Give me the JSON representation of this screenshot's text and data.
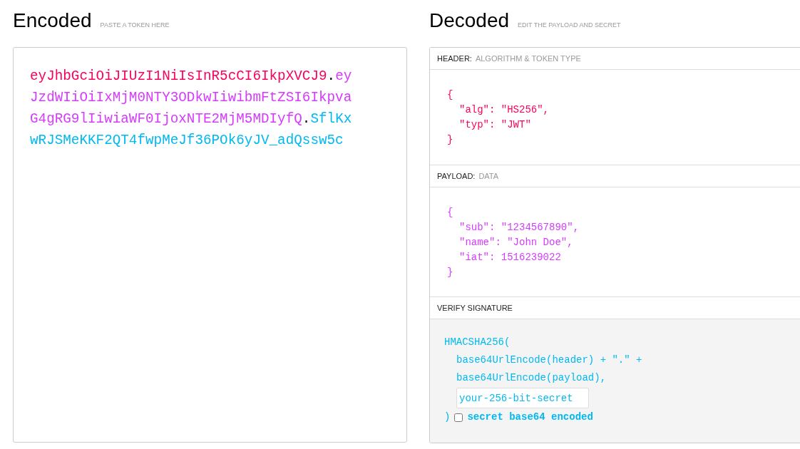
{
  "encoded": {
    "title": "Encoded",
    "hint": "PASTE A TOKEN HERE",
    "token": [
      {
        "text": "eyJhbGciOiJIUzI1NiIsInR5cCI6IkpXVCJ9",
        "color": "#fb015b"
      },
      {
        "text": ".",
        "color": "#000000"
      },
      {
        "text": "eyJzdWIiOiIxMjM0NTY3ODkwIiwibmFtZSI6IkpvaG4gRG9lIiwiaWF0IjoxNTE2MjM5MDIyfQ",
        "color": "#d63aff"
      },
      {
        "text": ".",
        "color": "#000000"
      },
      {
        "text": "SflKxwRJSMeKKF2QT4fwpMeJf36POk6yJV_adQssw5c",
        "color": "#00b9f1"
      }
    ]
  },
  "decoded": {
    "title": "Decoded",
    "hint": "EDIT THE PAYLOAD AND SECRET",
    "sections": [
      {
        "kind": "json",
        "label": "HEADER:",
        "sublabel": "ALGORITHM & TOKEN TYPE",
        "color": "#fb015b",
        "open": "{",
        "entries": [
          "\"alg\": \"HS256\",",
          "\"typ\": \"JWT\""
        ],
        "close": "}"
      },
      {
        "kind": "json",
        "label": "PAYLOAD:",
        "sublabel": "DATA",
        "color": "#d63aff",
        "open": "{",
        "entries": [
          "\"sub\": \"1234567890\",",
          "\"name\": \"John Doe\",",
          "\"iat\": 1516239022"
        ],
        "close": "}"
      },
      {
        "kind": "signature",
        "label": "VERIFY SIGNATURE",
        "color": "#00b9f1",
        "open": "HMACSHA256(",
        "entries": [
          "base64UrlEncode(header) + \".\" +",
          "base64UrlEncode(payload),"
        ],
        "secret": {
          "placeholder": "your-256-bit-secret"
        },
        "close": ")",
        "checkbox": {
          "label": "secret base64 encoded",
          "checked": false
        }
      }
    ]
  }
}
